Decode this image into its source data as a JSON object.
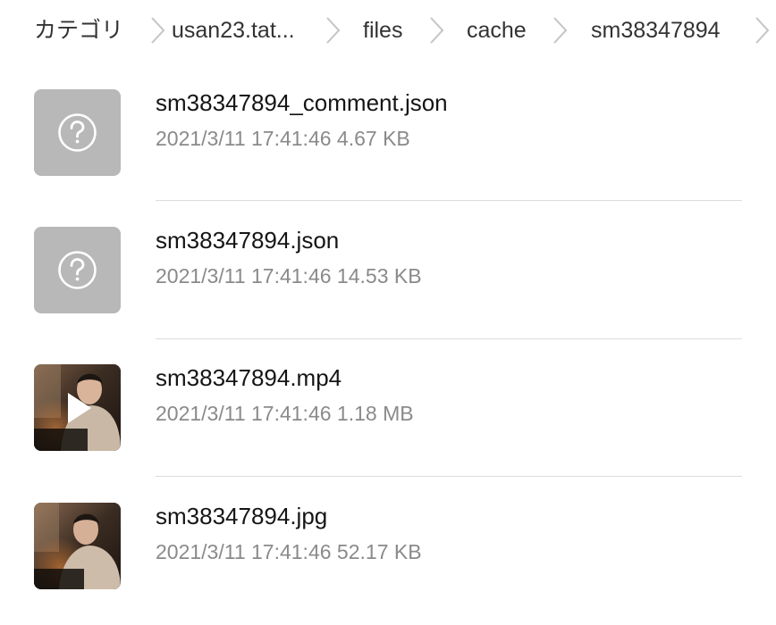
{
  "breadcrumb": {
    "items": [
      {
        "label": "カテゴリ"
      },
      {
        "label": "usan23.tat..."
      },
      {
        "label": "files"
      },
      {
        "label": "cache"
      },
      {
        "label": "sm38347894"
      }
    ],
    "separator_icon": "chevron-right-icon"
  },
  "files": [
    {
      "name": "sm38347894_comment.json",
      "date": "2021/3/11 17:41:46",
      "size": "4.67 KB",
      "meta": "2021/3/11 17:41:46 4.67 KB",
      "thumbnail": "unknown-file-icon"
    },
    {
      "name": "sm38347894.json",
      "date": "2021/3/11 17:41:46",
      "size": "14.53 KB",
      "meta": "2021/3/11 17:41:46 14.53 KB",
      "thumbnail": "unknown-file-icon"
    },
    {
      "name": "sm38347894.mp4",
      "date": "2021/3/11 17:41:46",
      "size": "1.18 MB",
      "meta": "2021/3/11 17:41:46 1.18 MB",
      "thumbnail": "video-thumbnail"
    },
    {
      "name": "sm38347894.jpg",
      "date": "2021/3/11 17:41:46",
      "size": "52.17 KB",
      "meta": "2021/3/11 17:41:46 52.17 KB",
      "thumbnail": "image-thumbnail"
    }
  ],
  "colors": {
    "unknown_thumb_bg": "#b8b8b8",
    "meta_text": "#8a8a8a",
    "chevron": "#c4c4c4",
    "divider": "#dcdcdc"
  }
}
